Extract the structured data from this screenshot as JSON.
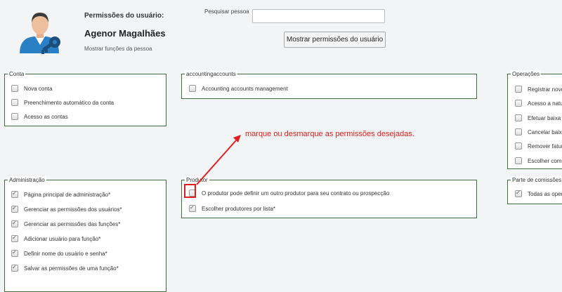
{
  "header": {
    "permissions_label": "Permissões do usuário:",
    "user_name": "Agenor Magalhães",
    "roles_link": "Mostrar funções da pessoa",
    "avatar_icon": "user-key-icon"
  },
  "search": {
    "label": "Pesquisar pessoa",
    "value": "",
    "placeholder": ""
  },
  "show_button": "Mostrar permissões do usuário",
  "panels": {
    "conta": {
      "legend": "Conta",
      "items": [
        {
          "label": "Nova conta",
          "checked": false
        },
        {
          "label": "Preenchimento automático da conta",
          "checked": false
        },
        {
          "label": "Acesso as contas",
          "checked": false
        }
      ]
    },
    "accountingaccounts": {
      "legend": "accountingaccounts",
      "items": [
        {
          "label": "Accounting accounts management",
          "checked": false
        }
      ]
    },
    "operacoes": {
      "legend": "Operações",
      "items": [
        {
          "label": "Registrar novo m",
          "checked": false
        },
        {
          "label": "Acesso a nature",
          "checked": false
        },
        {
          "label": "Efetuar baixa",
          "checked": false
        },
        {
          "label": "Cancelar baixa",
          "checked": false
        },
        {
          "label": "Remover fatura",
          "checked": false
        },
        {
          "label": "Escolher como re",
          "checked": false
        }
      ]
    },
    "administracao": {
      "legend": "Administração",
      "items": [
        {
          "label": "Página principal de administração*",
          "checked": true
        },
        {
          "label": "Gerenciar as permissões dos usuários*",
          "checked": true
        },
        {
          "label": "Gerenciar as permissões das funções*",
          "checked": true
        },
        {
          "label": "Adicionar usuário para função*",
          "checked": true
        },
        {
          "label": "Definir nome do usuário e senha*",
          "checked": true
        },
        {
          "label": "Salvar as permissões de uma função*",
          "checked": true
        }
      ]
    },
    "produtor": {
      "legend": "Produtor",
      "items": [
        {
          "label": "O produtor pode definir um outro produtor para seu contrato ou prospecção",
          "checked": false
        },
        {
          "label": "Escolher produtores por lista*",
          "checked": true
        }
      ]
    },
    "comissoes": {
      "legend": "Parte de comissões pa",
      "items": [
        {
          "label": "Todas as operaçõ",
          "checked": true
        }
      ]
    }
  },
  "annotation": {
    "text": "marque ou desmarque as permissões desejadas.",
    "color": "#e0201c"
  },
  "colors": {
    "panel_border": "#3f6f3f",
    "background": "#f2f4f6"
  }
}
